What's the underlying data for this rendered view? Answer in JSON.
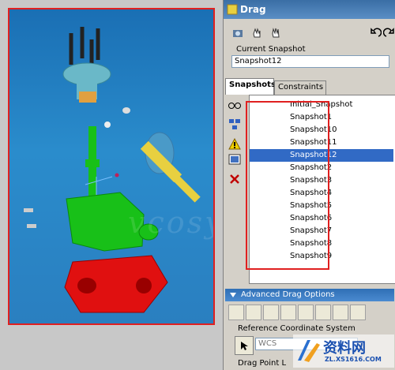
{
  "window": {
    "title": "Drag"
  },
  "toolbar": {
    "icons": [
      "snapshot-camera-icon",
      "hand-drag-icon",
      "hand-icon"
    ],
    "undo_icon": "undo-icon",
    "redo_icon": "redo-icon"
  },
  "current_snapshot": {
    "label": "Current Snapshot",
    "value": "Snapshot12"
  },
  "tabs": [
    {
      "label": "Snapshots",
      "active": true
    },
    {
      "label": "Constraints",
      "active": false
    }
  ],
  "snapshots": {
    "items": [
      "Initial_Snapshot",
      "Snapshot1",
      "Snapshot10",
      "Snapshot11",
      "Snapshot12",
      "Snapshot2",
      "Snapshot3",
      "Snapshot4",
      "Snapshot5",
      "Snapshot6",
      "Snapshot7",
      "Snapshot8",
      "Snapshot9"
    ],
    "selected": "Snapshot12"
  },
  "side_icons": [
    "glasses-icon",
    "explode-icon",
    "warning-icon",
    "image-icon",
    "delete-icon"
  ],
  "advanced": {
    "label": "Advanced Drag Options",
    "reference_label": "Reference Coordinate System",
    "reference_value": "WCS",
    "drag_point_label": "Drag Point L"
  },
  "watermark": "vcosys",
  "logo": {
    "text": "资料网",
    "url": "ZL.XS1616.COM"
  },
  "colors": {
    "accent": "#316ac5",
    "highlight": "#e02020",
    "viewport_bg": "#2a8ccc"
  }
}
